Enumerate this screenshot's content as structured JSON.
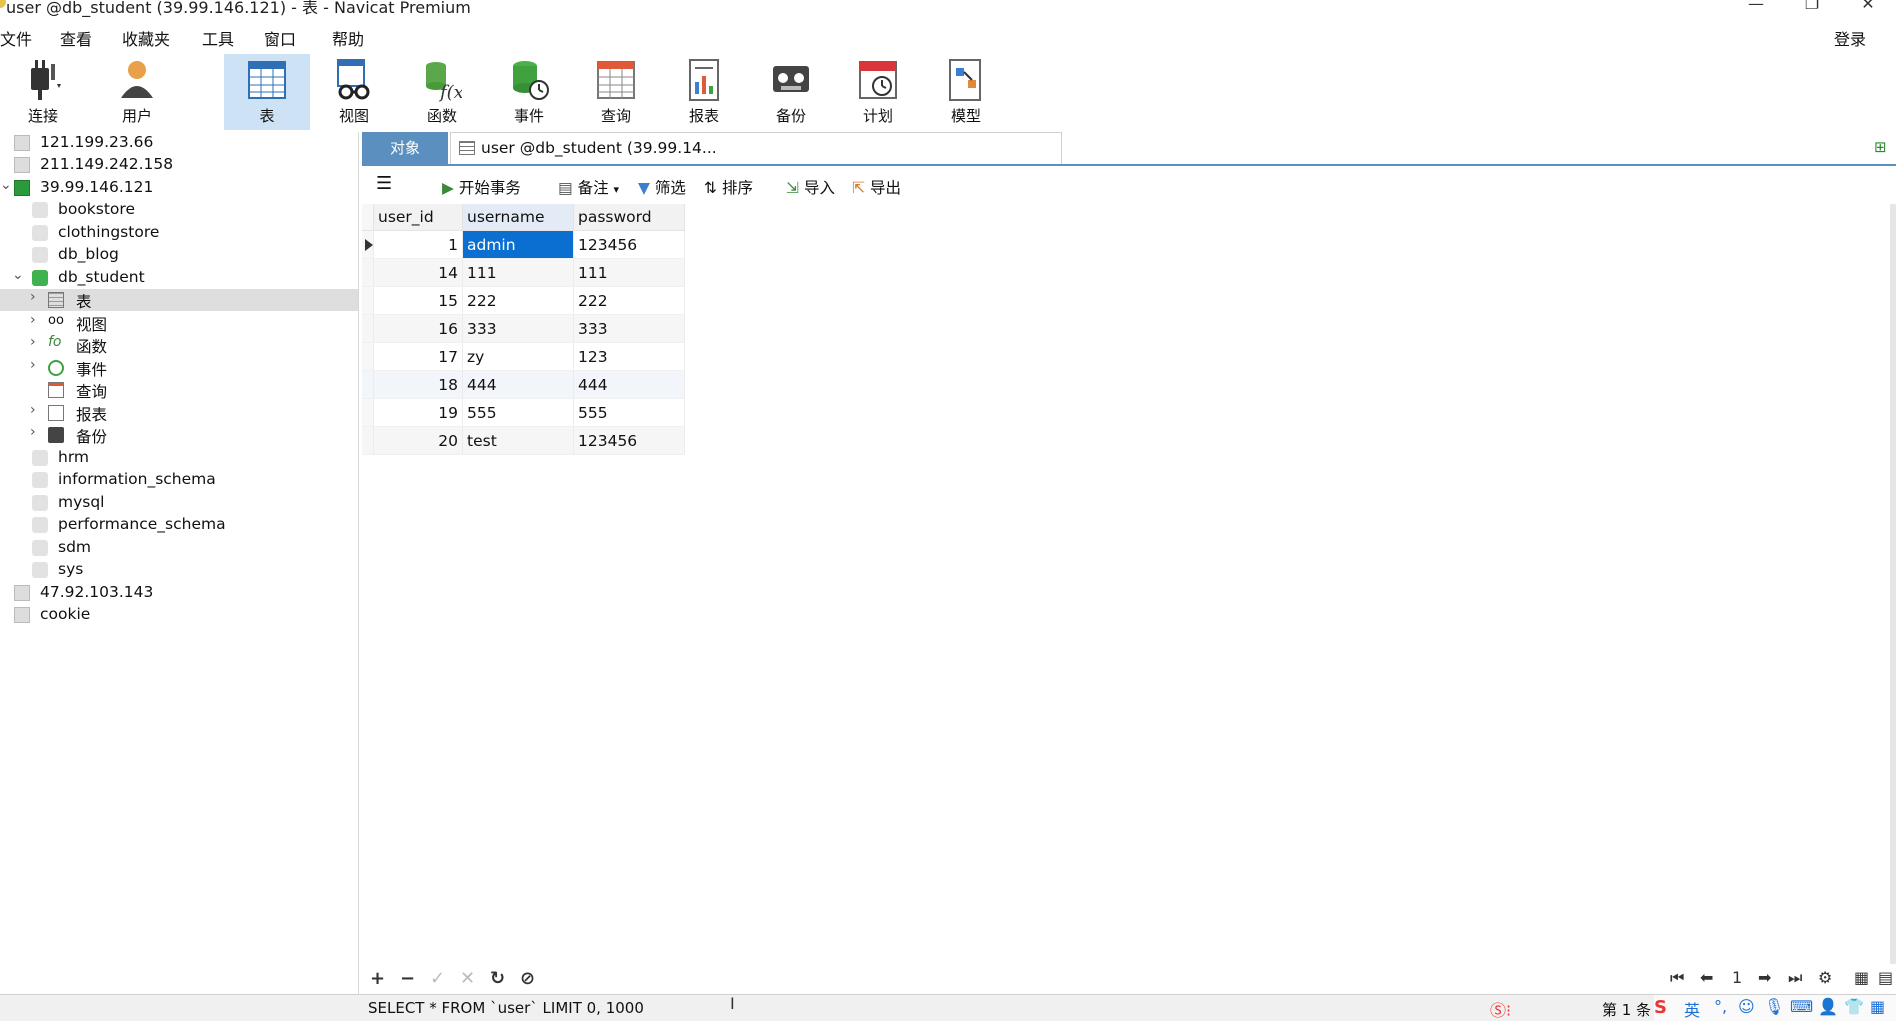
{
  "window": {
    "title": "user @db_student (39.99.146.121) - 表 - Navicat Premium",
    "controls": [
      "—",
      "❐",
      "✕"
    ]
  },
  "menu": [
    "文件",
    "查看",
    "收藏夹",
    "工具",
    "窗口",
    "帮助"
  ],
  "login": "登录",
  "toolbar": [
    {
      "label": "连接",
      "icon": "plug-icon"
    },
    {
      "label": "用户",
      "icon": "user-icon"
    },
    {
      "label": "表",
      "icon": "table-icon",
      "active": true
    },
    {
      "label": "视图",
      "icon": "view-icon"
    },
    {
      "label": "函数",
      "icon": "function-icon"
    },
    {
      "label": "事件",
      "icon": "event-icon"
    },
    {
      "label": "查询",
      "icon": "query-icon"
    },
    {
      "label": "报表",
      "icon": "report-icon"
    },
    {
      "label": "备份",
      "icon": "backup-icon"
    },
    {
      "label": "计划",
      "icon": "schedule-icon"
    },
    {
      "label": "模型",
      "icon": "model-icon"
    }
  ],
  "tree": [
    {
      "label": "121.199.23.66",
      "level": 0,
      "type": "server"
    },
    {
      "label": "211.149.242.158",
      "level": 0,
      "type": "server"
    },
    {
      "label": "39.99.146.121",
      "level": 0,
      "type": "server-open",
      "chev": "⌄"
    },
    {
      "label": "bookstore",
      "level": 1,
      "type": "db"
    },
    {
      "label": "clothingstore",
      "level": 1,
      "type": "db"
    },
    {
      "label": "db_blog",
      "level": 1,
      "type": "db"
    },
    {
      "label": "db_student",
      "level": 1,
      "type": "db-open",
      "chev": "⌄"
    },
    {
      "label": "表",
      "level": 2,
      "type": "tables",
      "chev": "›",
      "selected": true
    },
    {
      "label": "视图",
      "level": 2,
      "type": "views",
      "chev": "›"
    },
    {
      "label": "函数",
      "level": 2,
      "type": "functions",
      "chev": "›"
    },
    {
      "label": "事件",
      "level": 2,
      "type": "events",
      "chev": "›"
    },
    {
      "label": "查询",
      "level": 2,
      "type": "queries"
    },
    {
      "label": "报表",
      "level": 2,
      "type": "reports",
      "chev": "›"
    },
    {
      "label": "备份",
      "level": 2,
      "type": "backups",
      "chev": "›"
    },
    {
      "label": "hrm",
      "level": 1,
      "type": "db"
    },
    {
      "label": "information_schema",
      "level": 1,
      "type": "db"
    },
    {
      "label": "mysql",
      "level": 1,
      "type": "db"
    },
    {
      "label": "performance_schema",
      "level": 1,
      "type": "db"
    },
    {
      "label": "sdm",
      "level": 1,
      "type": "db"
    },
    {
      "label": "sys",
      "level": 1,
      "type": "db"
    },
    {
      "label": "47.92.103.143",
      "level": 0,
      "type": "server"
    },
    {
      "label": "cookie",
      "level": 0,
      "type": "server"
    }
  ],
  "tabs": {
    "objects": "对象",
    "active": "user @db_student (39.99.14..."
  },
  "subtoolbar": {
    "menu": "☰",
    "begin_tx": "开始事务",
    "memo": "备注",
    "filter": "筛选",
    "sort": "排序",
    "import": "导入",
    "export": "导出"
  },
  "table": {
    "columns": [
      "user_id",
      "username",
      "password"
    ],
    "rows": [
      [
        "1",
        "admin",
        "123456"
      ],
      [
        "14",
        "111",
        "111"
      ],
      [
        "15",
        "222",
        "222"
      ],
      [
        "16",
        "333",
        "333"
      ],
      [
        "17",
        "zy",
        "123"
      ],
      [
        "18",
        "444",
        "444"
      ],
      [
        "19",
        "555",
        "555"
      ],
      [
        "20",
        "test",
        "123456"
      ]
    ]
  },
  "bottom": {
    "add": "+",
    "remove": "−",
    "apply": "✓",
    "discard": "✕",
    "refresh": "↻",
    "stop": "⊘",
    "page": "1"
  },
  "status": {
    "sql": "SELECT * FROM `user` LIMIT 0, 1000",
    "record": "第 1 条"
  },
  "tray": {
    "ime_lang": "英"
  }
}
